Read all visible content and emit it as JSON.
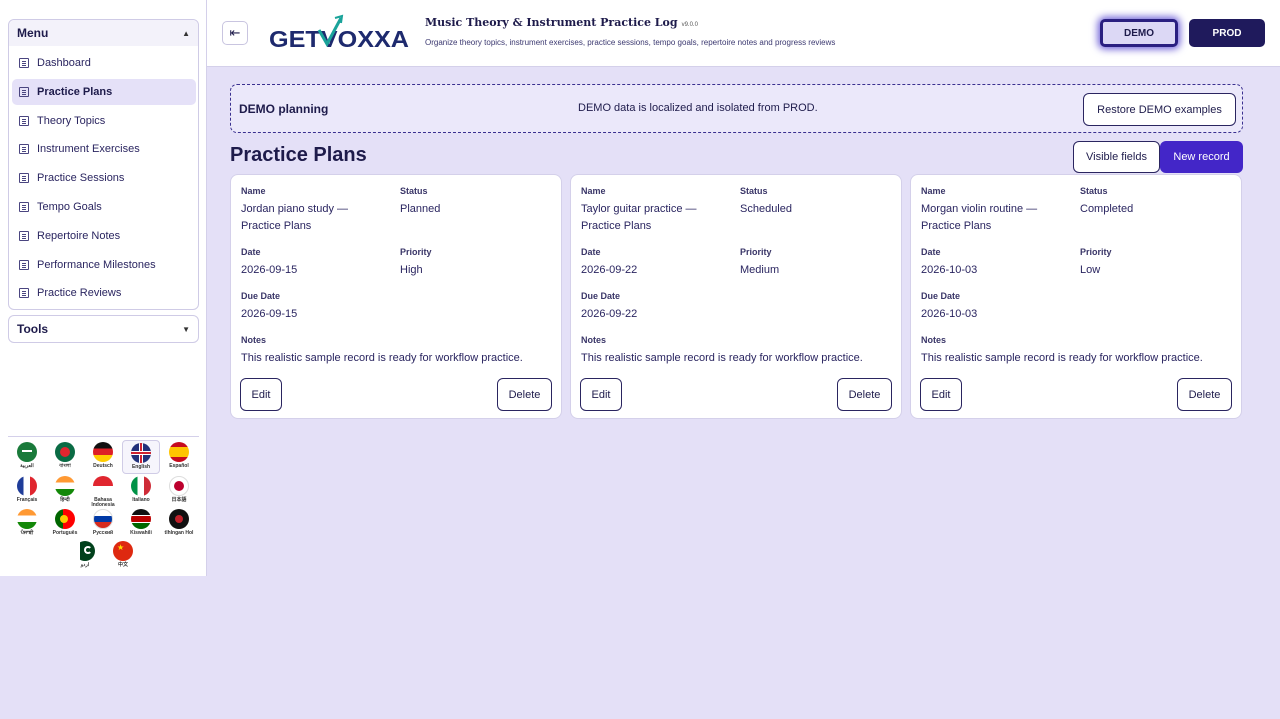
{
  "sidebar": {
    "menu_title": "Menu",
    "tools_title": "Tools",
    "items": [
      {
        "label": "Dashboard"
      },
      {
        "label": "Practice Plans"
      },
      {
        "label": "Theory Topics"
      },
      {
        "label": "Instrument Exercises"
      },
      {
        "label": "Practice Sessions"
      },
      {
        "label": "Tempo Goals"
      },
      {
        "label": "Repertoire Notes"
      },
      {
        "label": "Performance Milestones"
      },
      {
        "label": "Practice Reviews"
      }
    ],
    "languages": [
      {
        "label": "العربية"
      },
      {
        "label": "বাংলা"
      },
      {
        "label": "Deutsch"
      },
      {
        "label": "English"
      },
      {
        "label": "Español"
      },
      {
        "label": "Français"
      },
      {
        "label": "हिन्दी"
      },
      {
        "label": "Bahasa Indonesia"
      },
      {
        "label": "Italiano"
      },
      {
        "label": "日本語"
      },
      {
        "label": "ਪੰਜਾਬੀ"
      },
      {
        "label": "Português"
      },
      {
        "label": "Русский"
      },
      {
        "label": "Kiswahili"
      },
      {
        "label": "tlhIngan Hol"
      },
      {
        "label": "اردو"
      },
      {
        "label": "中文"
      }
    ]
  },
  "header": {
    "logo_text": "GETVOXXA",
    "title": "Music Theory & Instrument Practice Log",
    "version": "v9.0.0",
    "subtitle": "Organize theory topics, instrument exercises, practice sessions, tempo goals, repertoire notes and progress reviews",
    "demo_label": "DEMO",
    "prod_label": "PROD"
  },
  "banner": {
    "title": "DEMO planning",
    "message": "DEMO data is localized and isolated from PROD.",
    "restore_label": "Restore DEMO examples"
  },
  "main": {
    "page_title": "Practice Plans",
    "visible_fields_label": "Visible fields",
    "new_record_label": "New record",
    "labels": {
      "name": "Name",
      "status": "Status",
      "date": "Date",
      "priority": "Priority",
      "due_date": "Due Date",
      "notes": "Notes",
      "edit": "Edit",
      "delete": "Delete"
    },
    "records": [
      {
        "name": "Jordan piano study — Practice Plans",
        "status": "Planned",
        "date": "2026-09-15",
        "priority": "High",
        "due_date": "2026-09-15",
        "notes": "This realistic sample record is ready for workflow practice."
      },
      {
        "name": "Taylor guitar practice — Practice Plans",
        "status": "Scheduled",
        "date": "2026-09-22",
        "priority": "Medium",
        "due_date": "2026-09-22",
        "notes": "This realistic sample record is ready for workflow practice."
      },
      {
        "name": "Morgan violin routine — Practice Plans",
        "status": "Completed",
        "date": "2026-10-03",
        "priority": "Low",
        "due_date": "2026-10-03",
        "notes": "This realistic sample record is ready for workflow practice."
      }
    ]
  },
  "colors": {
    "accent": "#4326c8",
    "navy": "#1e1b4b",
    "background": "#e4e0f7"
  }
}
